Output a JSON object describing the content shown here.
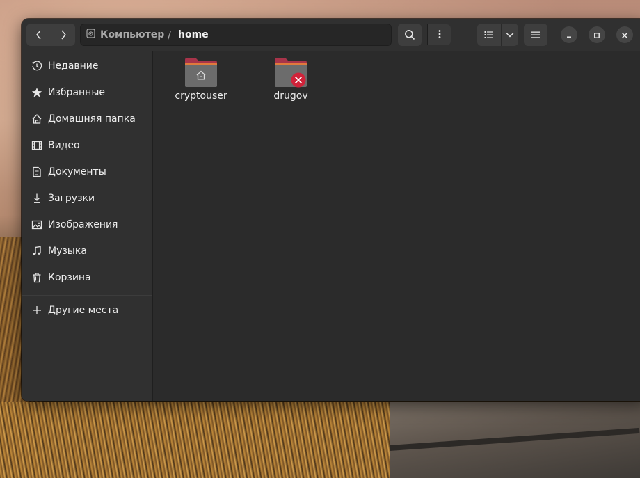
{
  "window": {
    "path_root": "Компьютер",
    "path_separator": "/",
    "path_current": "home"
  },
  "sidebar": {
    "items": [
      {
        "label": "Недавние",
        "icon": "clock-icon"
      },
      {
        "label": "Избранные",
        "icon": "star-icon"
      },
      {
        "label": "Домашняя папка",
        "icon": "home-icon"
      },
      {
        "label": "Видео",
        "icon": "film-icon"
      },
      {
        "label": "Документы",
        "icon": "document-icon"
      },
      {
        "label": "Загрузки",
        "icon": "download-icon"
      },
      {
        "label": "Изображения",
        "icon": "image-icon"
      },
      {
        "label": "Музыка",
        "icon": "music-icon"
      },
      {
        "label": "Корзина",
        "icon": "trash-icon"
      }
    ],
    "other_places": {
      "label": "Другие места",
      "icon": "plus-icon"
    }
  },
  "files": [
    {
      "name": "cryptouser",
      "emblem": "home-emblem-icon"
    },
    {
      "name": "drugov",
      "emblem": "no-access-emblem-icon"
    }
  ],
  "colors": {
    "folder_tab": "#a8344a",
    "folder_body": "#6a6a6a",
    "emblem_error": "#d0233a",
    "window_bg": "#2b2b2b",
    "sidebar_bg": "#303030"
  }
}
